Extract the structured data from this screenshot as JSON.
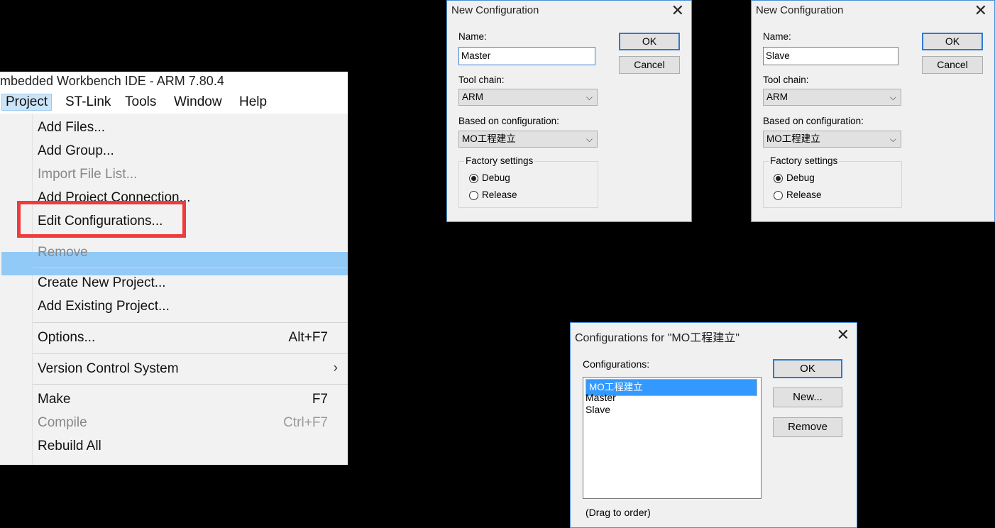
{
  "ide": {
    "title": "mbedded Workbench IDE - ARM 7.80.4",
    "menubar": [
      "Project",
      "ST-Link",
      "Tools",
      "Window",
      "Help"
    ],
    "menu_items": {
      "add_files": "Add Files...",
      "add_group": "Add Group...",
      "import_file_list": "Import File List...",
      "add_project_connection": "Add Project Connection...",
      "edit_configurations": "Edit Configurations...",
      "remove": "Remove",
      "create_new_project": "Create New Project...",
      "add_existing_project": "Add Existing Project...",
      "options": "Options...",
      "options_shortcut": "Alt+F7",
      "version_control": "Version Control System",
      "version_control_arrow": "›",
      "make": "Make",
      "make_shortcut": "F7",
      "compile": "Compile",
      "compile_shortcut": "Ctrl+F7",
      "rebuild_all": "Rebuild All"
    },
    "highlight_color": "#91c9f7",
    "callout_color": "#ef3b3b"
  },
  "dialog_master": {
    "title": "New Configuration",
    "close": "✕",
    "name_label": "Name:",
    "name_value": "Master",
    "toolchain_label": "Tool chain:",
    "toolchain_value": "ARM",
    "based_label": "Based on configuration:",
    "based_value": "MO工程建立",
    "factory_label": "Factory settings",
    "debug_label": "Debug",
    "release_label": "Release",
    "ok": "OK",
    "cancel": "Cancel"
  },
  "dialog_slave": {
    "title": "New Configuration",
    "close": "✕",
    "name_label": "Name:",
    "name_value": "Slave",
    "toolchain_label": "Tool chain:",
    "toolchain_value": "ARM",
    "based_label": "Based on configuration:",
    "based_value": "MO工程建立",
    "factory_label": "Factory settings",
    "debug_label": "Debug",
    "release_label": "Release",
    "ok": "OK",
    "cancel": "Cancel"
  },
  "dialog_configs": {
    "title": "Configurations for \"MO工程建立\"",
    "close": "✕",
    "configs_label": "Configurations:",
    "items": [
      "MO工程建立",
      "Master",
      "Slave"
    ],
    "hint": "(Drag to order)",
    "ok": "OK",
    "new": "New...",
    "remove": "Remove"
  }
}
